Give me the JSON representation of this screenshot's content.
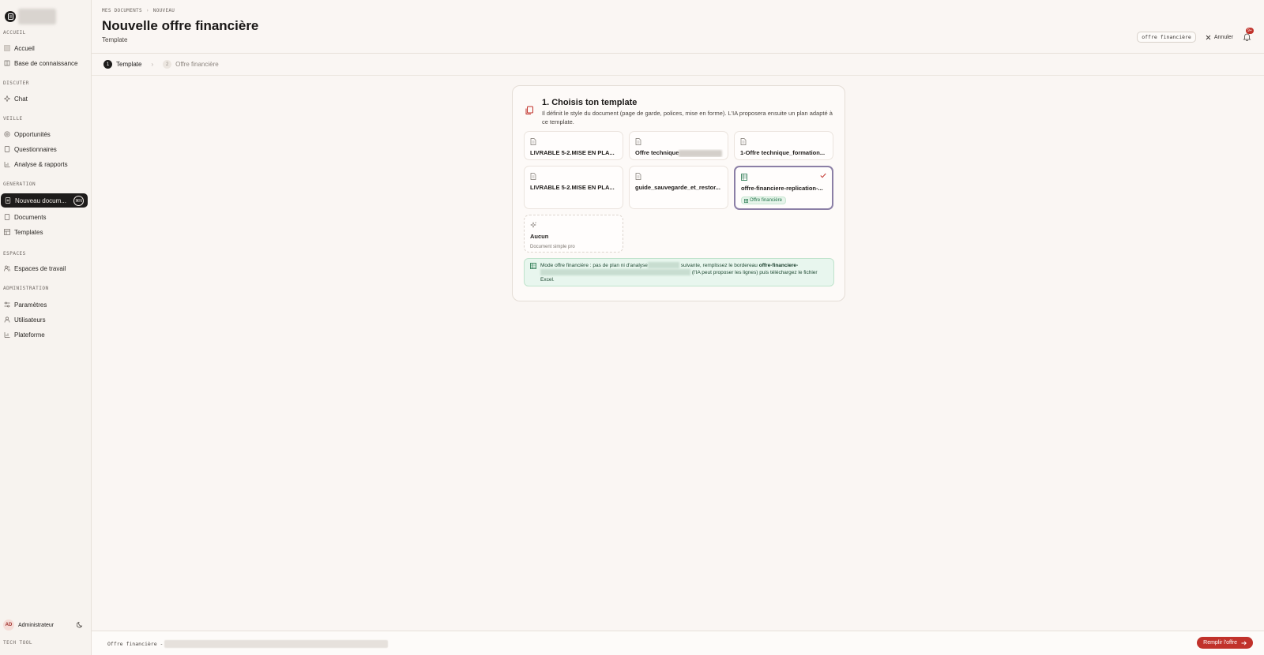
{
  "sidebar": {
    "sections": [
      {
        "title": "ACCUEIL",
        "items": [
          {
            "label": "Accueil",
            "icon": "square-icon"
          },
          {
            "label": "Base de connaissance",
            "icon": "book-icon"
          }
        ]
      },
      {
        "title": "DISCUTER",
        "items": [
          {
            "label": "Chat",
            "icon": "sparkle-icon"
          }
        ]
      },
      {
        "title": "VEILLE",
        "items": [
          {
            "label": "Opportunités",
            "icon": "target-icon"
          },
          {
            "label": "Questionnaires",
            "icon": "document-icon"
          },
          {
            "label": "Analyse & rapports",
            "icon": "bar-chart-icon"
          }
        ]
      },
      {
        "title": "GENERATION",
        "items": [
          {
            "label": "Nouveau docum...",
            "icon": "file-plus-icon",
            "badge": "⌘N"
          },
          {
            "label": "Documents",
            "icon": "document-icon"
          },
          {
            "label": "Templates",
            "icon": "layout-icon"
          }
        ]
      },
      {
        "title": "ESPACES",
        "items": [
          {
            "label": "Espaces de travail",
            "icon": "users-icon"
          }
        ]
      },
      {
        "title": "ADMINISTRATION",
        "items": [
          {
            "label": "Paramètres",
            "icon": "sliders-icon"
          },
          {
            "label": "Utilisateurs",
            "icon": "user-icon"
          },
          {
            "label": "Plateforme",
            "icon": "bar-chart-icon"
          }
        ]
      }
    ],
    "user": {
      "initials": "AD",
      "name": "Administrateur"
    },
    "footer_label": "TECH TOOL"
  },
  "header": {
    "breadcrumb": [
      "MES DOCUMENTS",
      "NOUVEAU"
    ],
    "title": "Nouvelle offre financière",
    "subtitle": "Template",
    "mode_pill": "offre financière",
    "cancel_label": "Annuler",
    "notif_badge": "9+"
  },
  "steps": [
    {
      "num": "1",
      "label": "Template",
      "active": true
    },
    {
      "num": "2",
      "label": "Offre financière",
      "active": false
    }
  ],
  "card": {
    "title": "1. Choisis ton template",
    "description": "Il définit le style du document (page de garde, polices, mise en forme). L'IA proposera ensuite un plan adapté à ce template.",
    "templates": [
      {
        "name": "LIVRABLE 5-2.MISE EN PLA...",
        "icon": "file-icon"
      },
      {
        "name": "Offre technique",
        "icon": "file-icon"
      },
      {
        "name": "1-Offre technique_formation...",
        "icon": "file-icon"
      },
      {
        "name": "LIVRABLE 5-2.MISE EN PLA...",
        "icon": "file-icon"
      },
      {
        "name": "guide_sauvegarde_et_restor...",
        "icon": "file-icon"
      },
      {
        "name": "offre-financiere-replication-...",
        "icon": "spreadsheet-icon",
        "tag": "Offre financière",
        "selected": true
      }
    ],
    "none_option": {
      "name": "Aucun",
      "subtitle": "Document simple pro"
    },
    "info": {
      "text_a": "Mode offre financière : pas de plan ni d'analyse",
      "text_b": "suivante, remplissez le bordereau",
      "bold": "offre-financiere-",
      "text_c": "(l'IA peut proposer les lignes) puis téléchargez le fichier Excel."
    }
  },
  "footer": {
    "label": "Offre financière -",
    "primary_button": "Remplir l'offre"
  },
  "colors": {
    "accent_red": "#c1322b",
    "dark": "#1e1c1b",
    "selected_border": "#8b7fa6",
    "info_green": "#e8f6ee"
  }
}
